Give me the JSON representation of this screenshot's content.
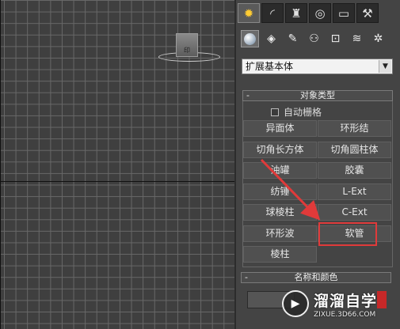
{
  "tabs": [
    {
      "icon": "create-icon",
      "glyph": "✹",
      "active": true
    },
    {
      "icon": "modify-icon",
      "glyph": "◜",
      "active": false
    },
    {
      "icon": "hierarchy-icon",
      "glyph": "♜",
      "active": false
    },
    {
      "icon": "motion-icon",
      "glyph": "◎",
      "active": false
    },
    {
      "icon": "display-icon",
      "glyph": "▭",
      "active": false
    },
    {
      "icon": "utilities-icon",
      "glyph": "⚒",
      "active": false
    }
  ],
  "categories": [
    {
      "icon": "geometry-icon",
      "glyph": "",
      "active": true
    },
    {
      "icon": "shapes-icon",
      "glyph": "◈",
      "active": false
    },
    {
      "icon": "lights-icon",
      "glyph": "✎",
      "active": false
    },
    {
      "icon": "cameras-icon",
      "glyph": "⚇",
      "active": false
    },
    {
      "icon": "helpers-icon",
      "glyph": "⊡",
      "active": false
    },
    {
      "icon": "spacewarps-icon",
      "glyph": "≋",
      "active": false
    },
    {
      "icon": "systems-icon",
      "glyph": "✲",
      "active": false
    }
  ],
  "dropdown": {
    "value": "扩展基本体"
  },
  "object_type": {
    "title": "对象类型",
    "collapse": "-",
    "autogrid_label": "自动栅格",
    "buttons": [
      [
        "异面体",
        "环形结"
      ],
      [
        "切角长方体",
        "切角圆柱体"
      ],
      [
        "油罐",
        "胶囊"
      ],
      [
        "纺锤",
        "L-Ext"
      ],
      [
        "球棱柱",
        "C-Ext"
      ],
      [
        "环形波",
        "软管"
      ],
      [
        "棱柱",
        ""
      ]
    ]
  },
  "name_color": {
    "title": "名称和颜色",
    "collapse": "-"
  },
  "viewport": {
    "object_label": "印"
  },
  "annotation_color": "#e03a3a",
  "watermark": {
    "title": "溜溜自学",
    "url": "ZIXUE.3D66.COM"
  }
}
